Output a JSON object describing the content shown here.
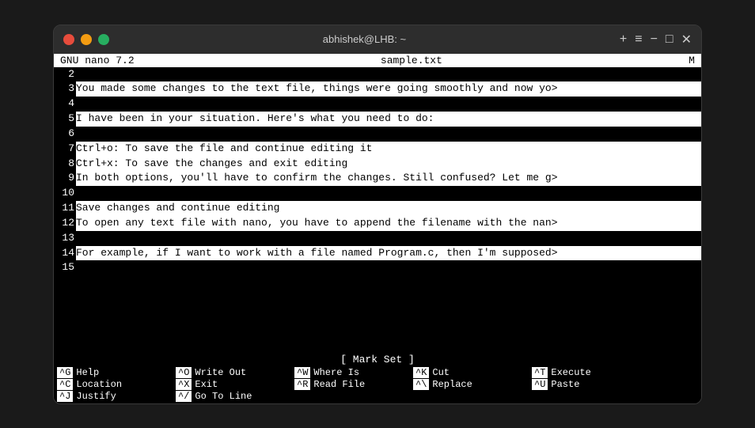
{
  "titlebar": {
    "title": "abhishek@LHB: ~",
    "add_tab": "+",
    "menu": "≡",
    "minimize": "−",
    "maximize": "□",
    "close": "✕"
  },
  "nano": {
    "header": {
      "left": "GNU nano 7.2",
      "center": "sample.txt",
      "right": "M"
    },
    "mark_bar": "[ Mark Set ]",
    "lines": [
      {
        "num": "2",
        "content": "",
        "selected": false
      },
      {
        "num": "3",
        "content": "You made some changes to the text file, things were going smoothly and now yo>",
        "selected": true
      },
      {
        "num": "4",
        "content": "",
        "selected": false
      },
      {
        "num": "5",
        "content": "I have been in your situation. Here's what you need to do:",
        "selected": true
      },
      {
        "num": "6",
        "content": "",
        "selected": false
      },
      {
        "num": "7",
        "content": "Ctrl+o: To save the file and continue editing it",
        "selected": true
      },
      {
        "num": "8",
        "content": "Ctrl+x: To save the changes and exit editing",
        "selected": true,
        "cursor": true
      },
      {
        "num": "9",
        "content": "In both options, you'll have to confirm the changes. Still confused? Let me g>",
        "selected": true
      },
      {
        "num": "10",
        "content": "",
        "selected": false
      },
      {
        "num": "11",
        "content": "Save changes and continue editing",
        "selected": true
      },
      {
        "num": "12",
        "content": "To open any text file with nano, you have to append the filename with the nan>",
        "selected": true
      },
      {
        "num": "13",
        "content": "",
        "selected": false
      },
      {
        "num": "14",
        "content": "For example, if I want to work with a file named Program.c, then I'm supposed>",
        "selected": true
      },
      {
        "num": "15",
        "content": "",
        "selected": false
      }
    ],
    "footer": [
      {
        "key": "^G",
        "label": "Help"
      },
      {
        "key": "^O",
        "label": "Write Out"
      },
      {
        "key": "^W",
        "label": "Where Is"
      },
      {
        "key": "^K",
        "label": "Cut"
      },
      {
        "key": "^T",
        "label": "Execute"
      },
      {
        "key": "^C",
        "label": "Location"
      },
      {
        "key": "^X",
        "label": "Exit"
      },
      {
        "key": "^R",
        "label": "Read File"
      },
      {
        "key": "^\\",
        "label": "Replace"
      },
      {
        "key": "^U",
        "label": "Paste"
      },
      {
        "key": "^J",
        "label": "Justify"
      },
      {
        "key": "^/",
        "label": "Go To Line"
      }
    ]
  }
}
